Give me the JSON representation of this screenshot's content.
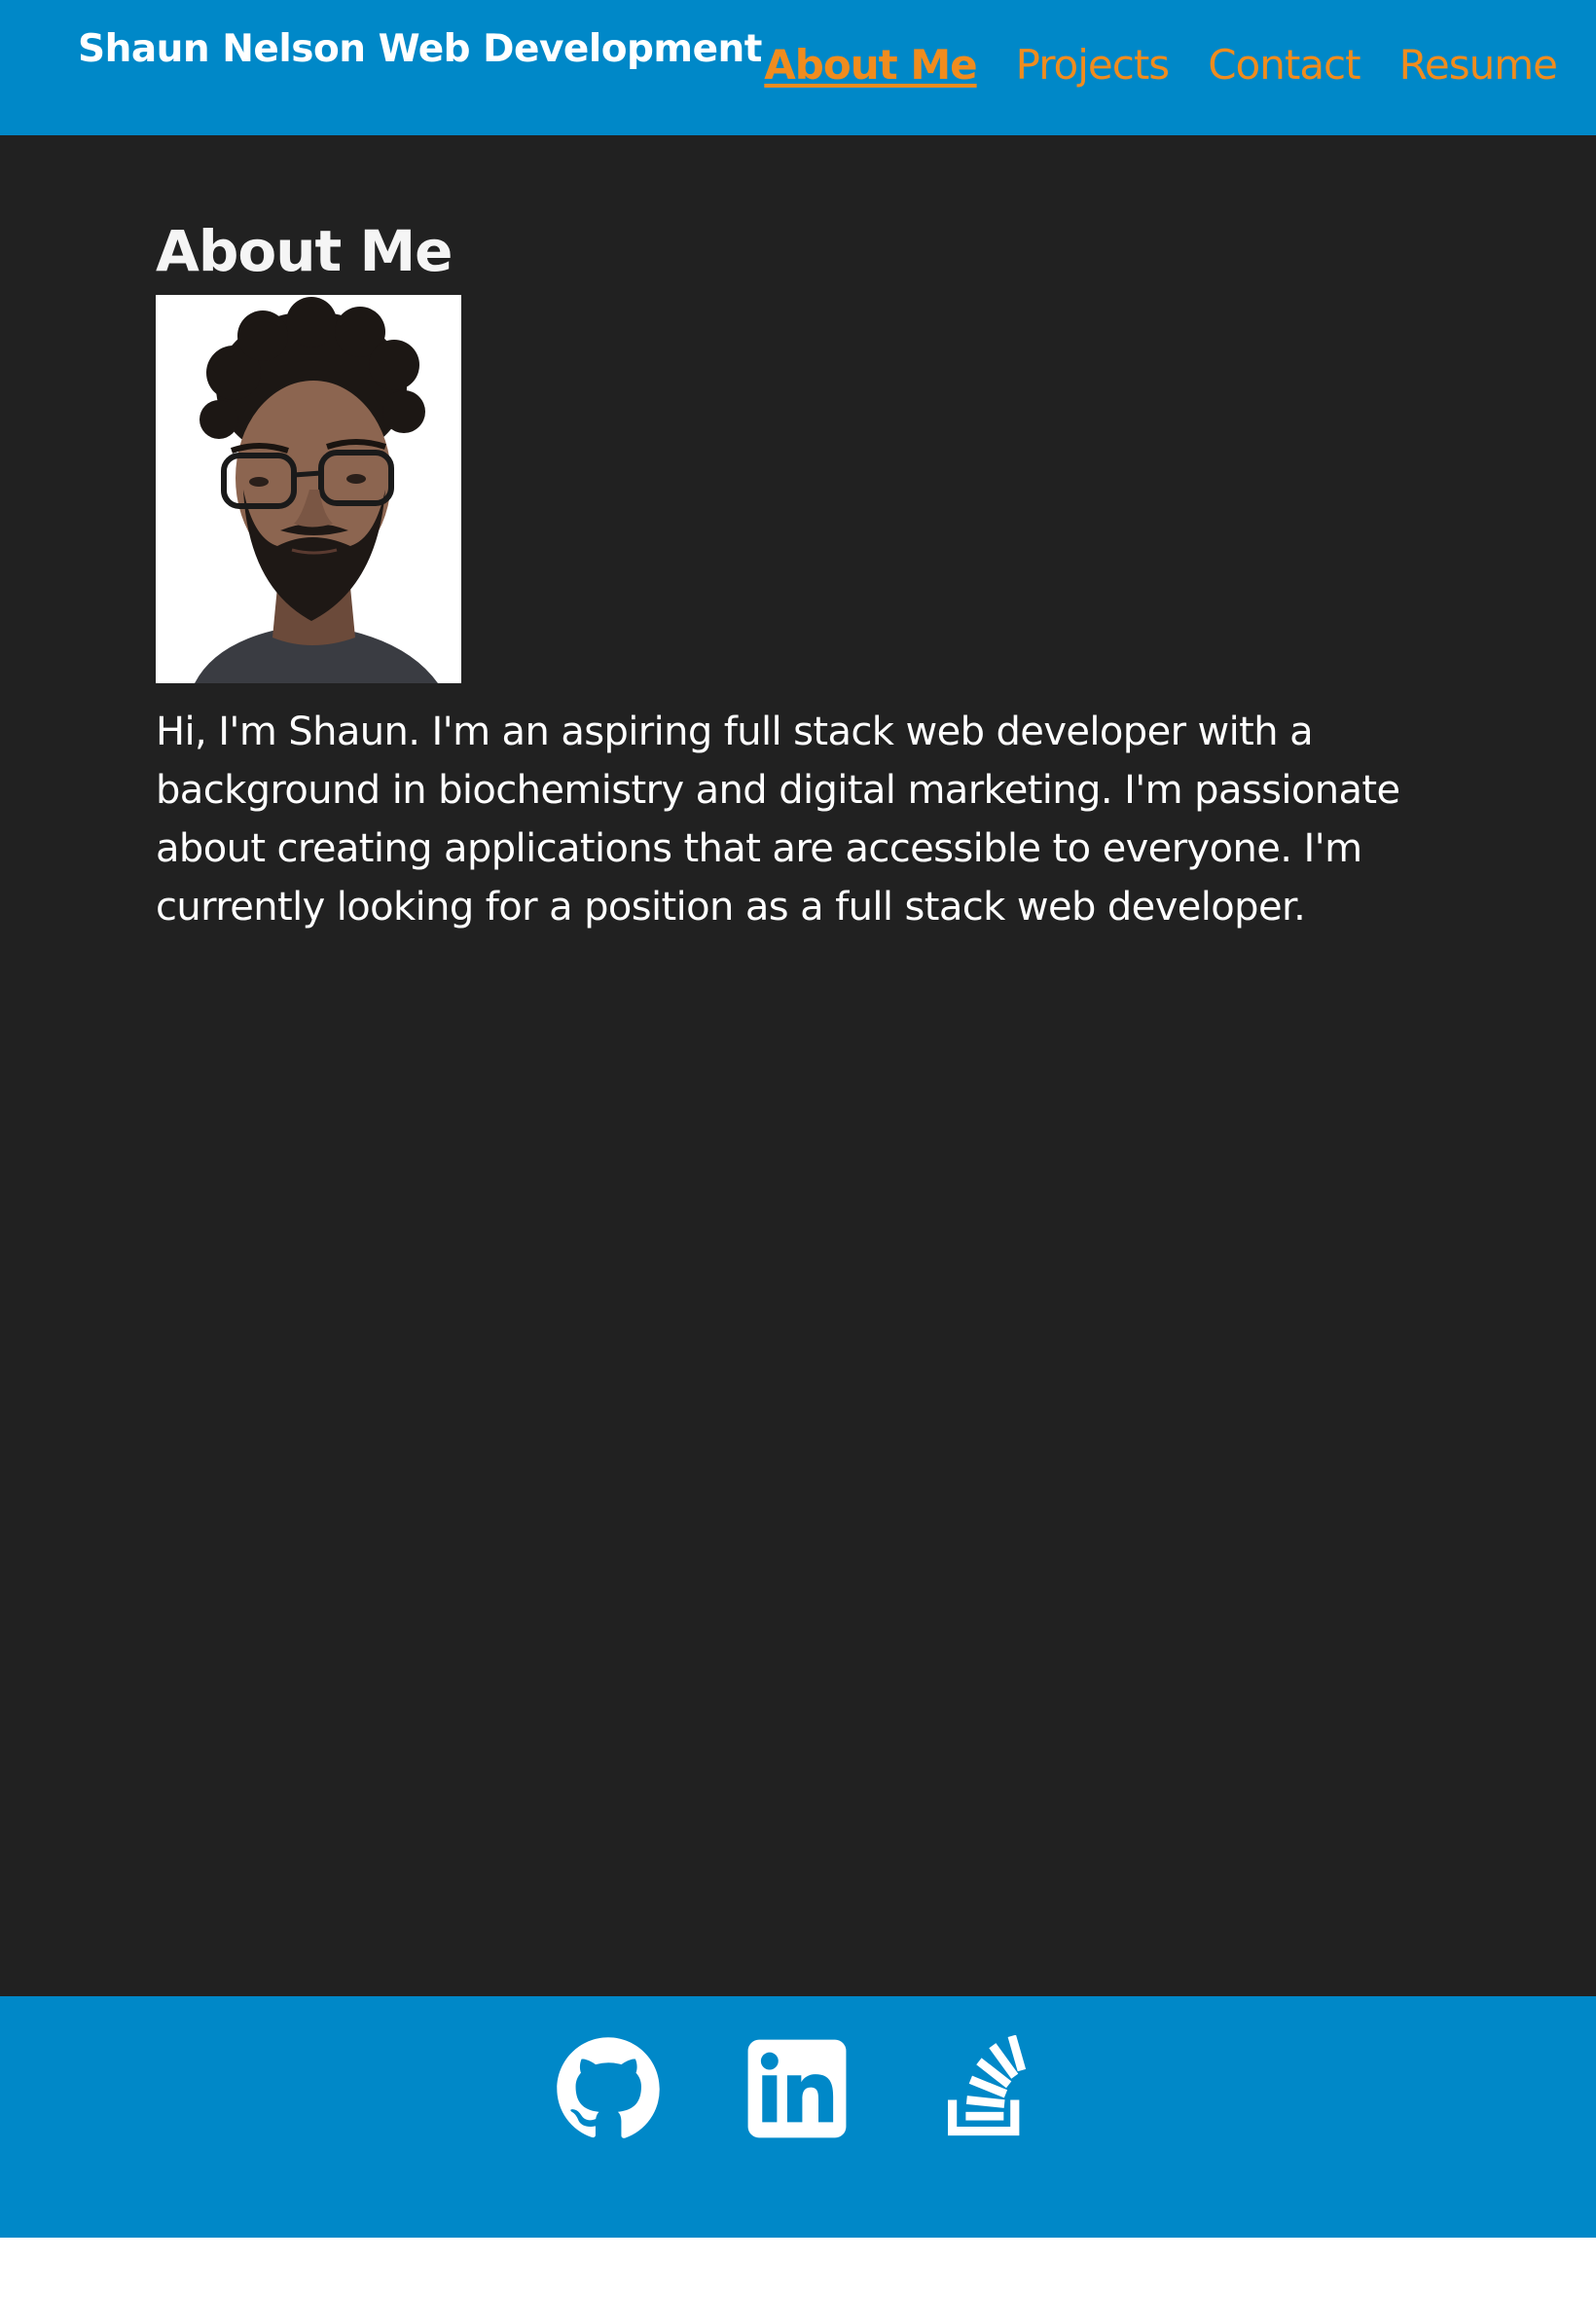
{
  "header": {
    "brand": "Shaun Nelson Web Development",
    "nav": [
      {
        "label": "About Me",
        "active": true
      },
      {
        "label": "Projects",
        "active": false
      },
      {
        "label": "Contact",
        "active": false
      },
      {
        "label": "Resume",
        "active": false
      }
    ]
  },
  "main": {
    "title": "About Me",
    "bio": "Hi, I'm Shaun. I'm an aspiring full stack web developer with a background in biochemistry and digital marketing. I'm passionate about creating applications that are accessible to everyone. I'm currently looking for a position as a full stack web developer."
  },
  "footer": {
    "links": [
      {
        "icon": "github-icon"
      },
      {
        "icon": "linkedin-icon"
      },
      {
        "icon": "stack-overflow-icon"
      }
    ]
  },
  "colors": {
    "header_bg": "#0088c8",
    "main_bg": "#212121",
    "nav_link": "#f08c1e",
    "text": "#ffffff"
  }
}
